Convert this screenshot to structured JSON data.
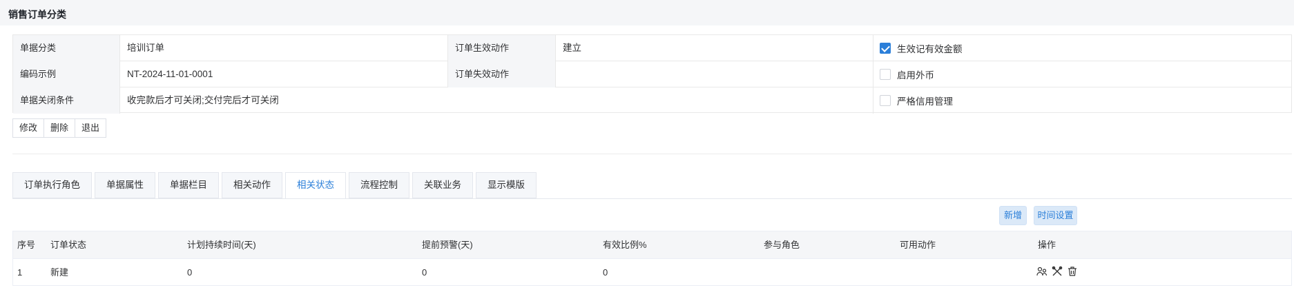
{
  "header": {
    "title": "销售订单分类"
  },
  "form": {
    "row1": {
      "label1": "单据分类",
      "value1": "培训订单",
      "label2": "订单生效动作",
      "value2": "建立"
    },
    "row2": {
      "label1": "编码示例",
      "value1": "NT-2024-11-01-0001",
      "label2": "订单失效动作",
      "value2": ""
    },
    "row3": {
      "label1": "单据关闭条件",
      "value1": "收完款后才可关闭;交付完后才可关闭"
    },
    "checkboxes": [
      {
        "label": "生效记有效金额",
        "checked": true
      },
      {
        "label": "启用外币",
        "checked": false
      },
      {
        "label": "严格信用管理",
        "checked": false
      }
    ]
  },
  "actions": {
    "edit": "修改",
    "delete": "删除",
    "exit": "退出"
  },
  "tabs": [
    "订单执行角色",
    "单据属性",
    "单据栏目",
    "相关动作",
    "相关状态",
    "流程控制",
    "关联业务",
    "显示模版"
  ],
  "active_tab": "相关状态",
  "list_actions": {
    "add": "新增",
    "time_settings": "时间设置"
  },
  "table": {
    "headers": [
      "序号",
      "订单状态",
      "计划持续时间(天)",
      "提前预警(天)",
      "有效比例%",
      "参与角色",
      "可用动作",
      "操作"
    ],
    "rows": [
      {
        "no": "1",
        "status": "新建",
        "duration": "0",
        "warning": "0",
        "ratio": "0",
        "roles": "",
        "actions": ""
      }
    ]
  },
  "colors": {
    "accent": "#2b7fd9",
    "header_bg": "#f5f6f8"
  },
  "icons": [
    "users-icon",
    "tools-icon",
    "trash-icon"
  ]
}
